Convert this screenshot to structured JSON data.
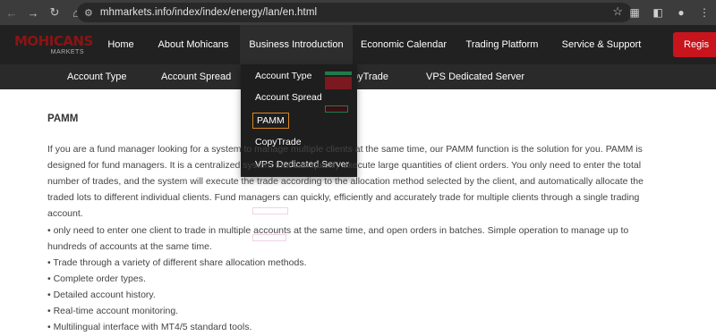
{
  "browser": {
    "url": "mhmarkets.info/index/index/energy/lan/en.html"
  },
  "header": {
    "logo_main": "MOHICANS",
    "logo_sub": "MARKETS",
    "nav": [
      {
        "label": "Home"
      },
      {
        "label": "About Mohicans"
      },
      {
        "label": "Business Introduction"
      },
      {
        "label": "Economic Calendar"
      },
      {
        "label": "Trading Platform"
      },
      {
        "label": "Service & Support"
      }
    ],
    "register_label": "Regis"
  },
  "sub_nav": [
    {
      "label": "Account Type"
    },
    {
      "label": "Account Spread"
    },
    {
      "label": "pyTrade"
    },
    {
      "label": "VPS Dedicated Server"
    }
  ],
  "dropdown": {
    "items": [
      {
        "label": "Account Type"
      },
      {
        "label": "Account Spread"
      },
      {
        "label": "PAMM"
      },
      {
        "label": "CopyTrade"
      },
      {
        "label": "VPS Dedicated Server"
      }
    ]
  },
  "content": {
    "title": "PAMM",
    "paragraph": "If you are a fund manager looking for a system to manage multiple clients at the same time, our PAMM function is the solution for you. PAMM is designed for fund managers. It is a centralized system that can quickly execute large quantities of client orders. You only need to enter the total number of trades, and the system will execute the trade according to the allocation method selected by the client, and automatically allocate the traded lots to different individual clients. Fund managers can quickly, efficiently and accurately trade for multiple clients through a single trading account.",
    "bullets": [
      "• only need to enter one client to trade in multiple accounts at the same time, and open orders in batches. Simple operation to manage up to hundreds of accounts at the same time.",
      "• Trade through a variety of different share allocation methods.",
      "• Complete order types.",
      "• Detailed account history.",
      "• Real-time account monitoring.",
      "• Multilingual interface with MT4/5 standard tools."
    ]
  },
  "colors": {
    "header_bg": "#212121",
    "subnav_bg": "#2a2a2a",
    "brand_red": "#c8141d",
    "active_outline": "#d9861f"
  }
}
